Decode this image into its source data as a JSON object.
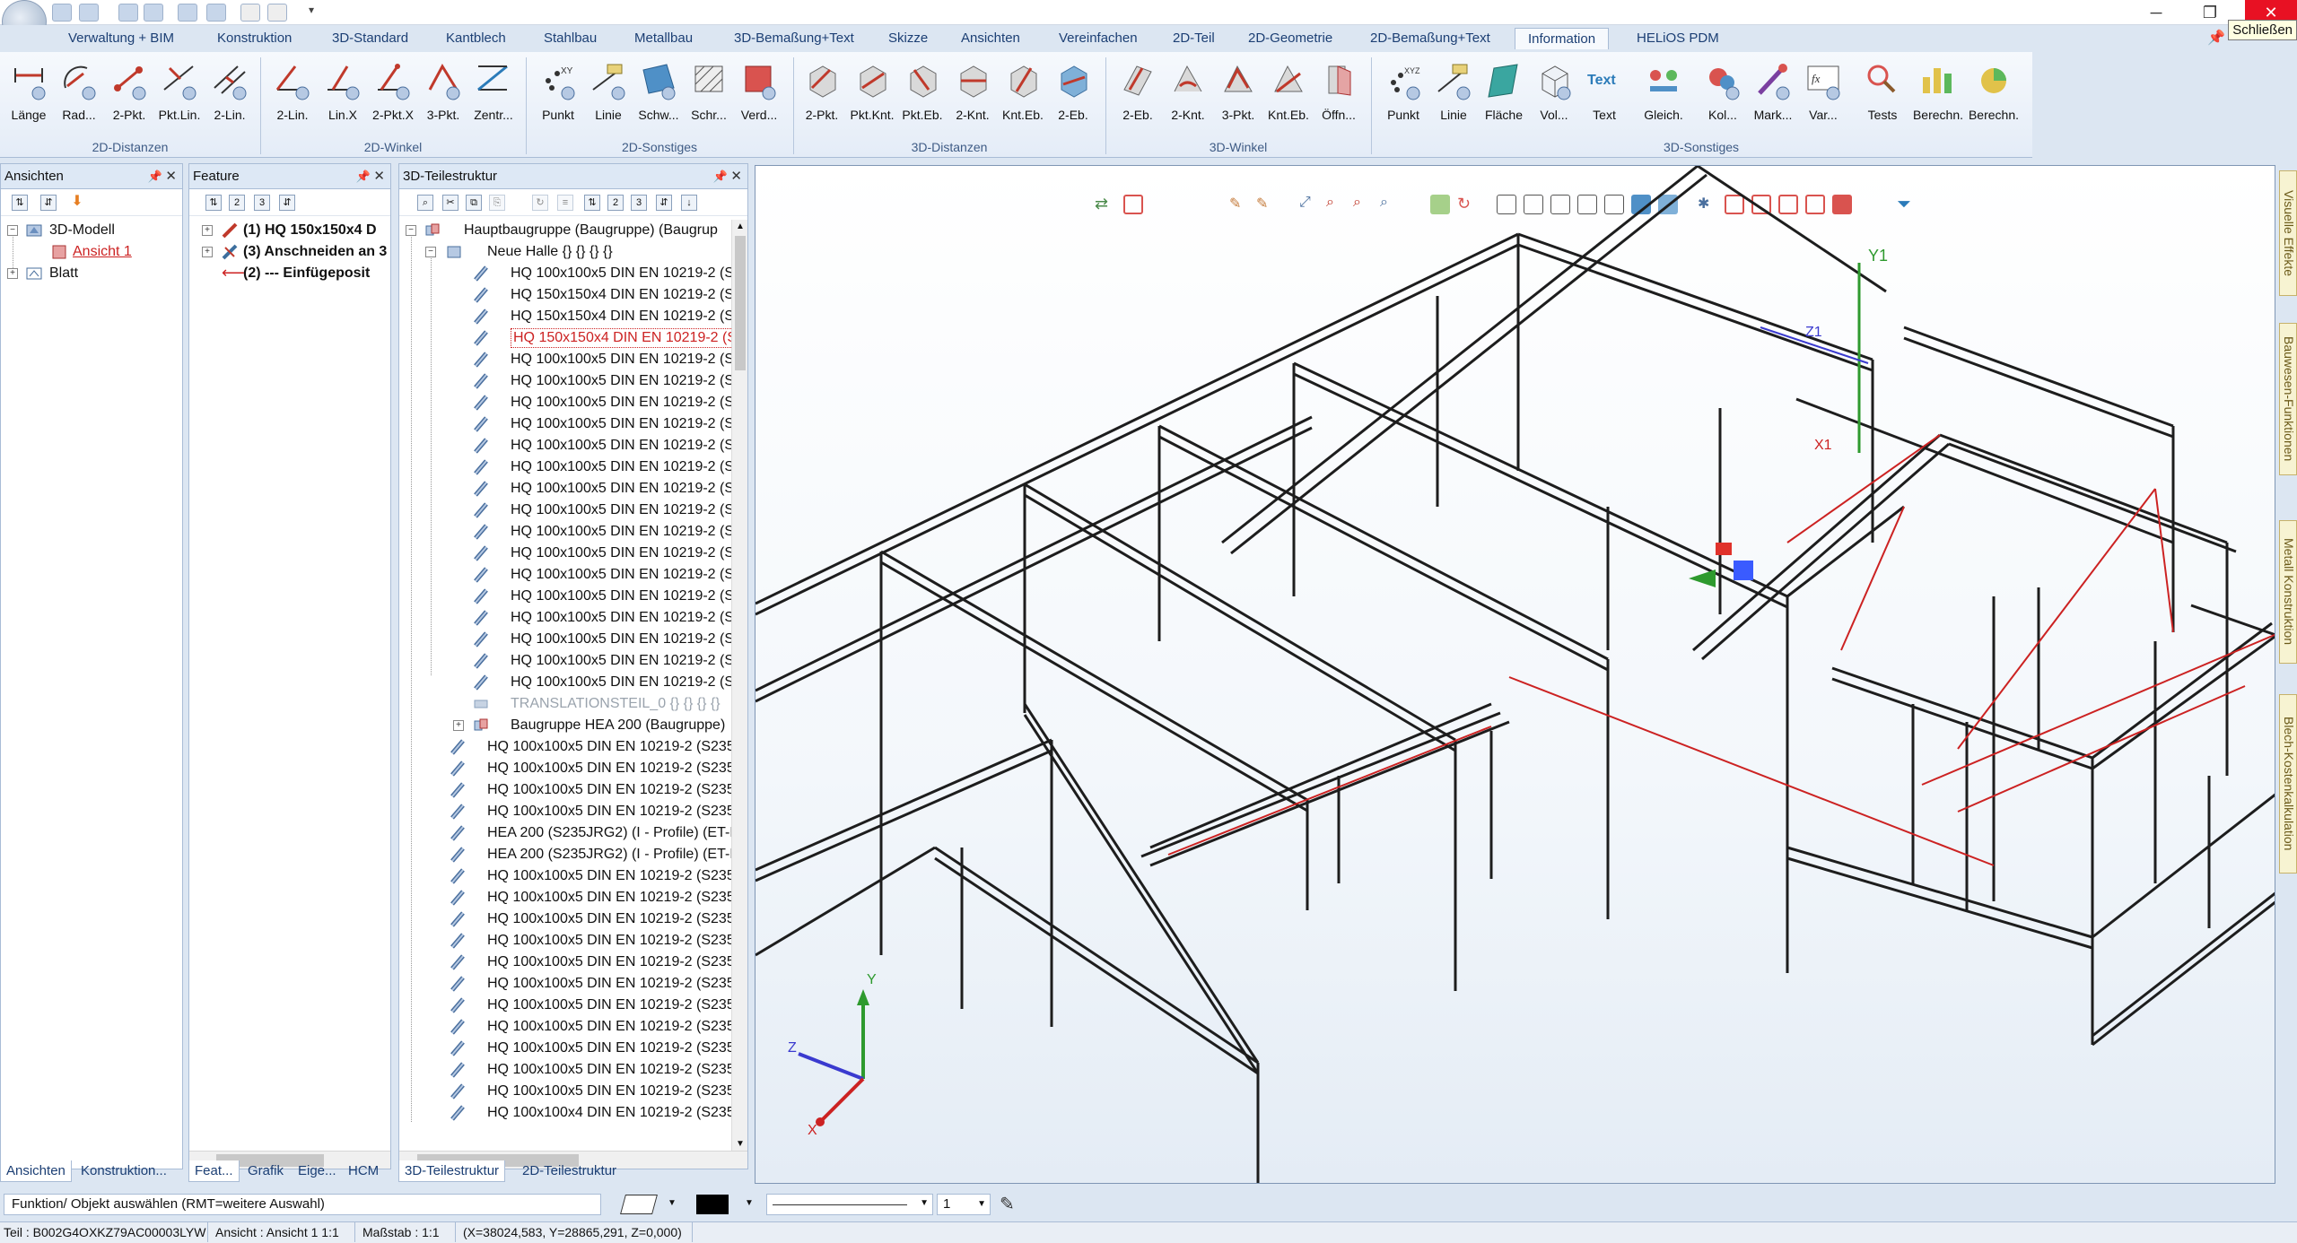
{
  "window": {
    "close_tooltip": "Schließen"
  },
  "menu_tabs": [
    "Verwaltung + BIM",
    "Konstruktion",
    "3D-Standard",
    "Kantblech",
    "Stahlbau",
    "Metallbau",
    "3D-Bemaßung+Text",
    "Skizze",
    "Ansichten",
    "Vereinfachen",
    "2D-Teil",
    "2D-Geometrie",
    "2D-Bemaßung+Text",
    "Information",
    "HELiOS PDM"
  ],
  "active_tab": "Information",
  "ribbon_groups": [
    {
      "label": "2D-Distanzen",
      "buttons": [
        "Länge",
        "Rad...",
        "2-Pkt.",
        "Pkt.Lin.",
        "2-Lin."
      ]
    },
    {
      "label": "2D-Winkel",
      "buttons": [
        "2-Lin.",
        "Lin.X",
        "2-Pkt.X",
        "3-Pkt.",
        "Zentr..."
      ]
    },
    {
      "label": "2D-Sonstiges",
      "buttons": [
        "Punkt",
        "Linie",
        "Schw...",
        "Schr...",
        "Verd..."
      ]
    },
    {
      "label": "3D-Distanzen",
      "buttons": [
        "2-Pkt.",
        "Pkt.Knt.",
        "Pkt.Eb.",
        "2-Knt.",
        "Knt.Eb.",
        "2-Eb."
      ]
    },
    {
      "label": "3D-Winkel",
      "buttons": [
        "2-Eb.",
        "2-Knt.",
        "3-Pkt.",
        "Knt.Eb.",
        "Öffn..."
      ]
    },
    {
      "label": "3D-Sonstiges",
      "buttons": [
        "Punkt",
        "Linie",
        "Fläche",
        "Vol...",
        "Text",
        "Gleich.",
        "Kol...",
        "Mark...",
        "Var...",
        "Tests",
        "Berechn.",
        "Berechn."
      ]
    }
  ],
  "text_button_glyph": "Text",
  "panels": {
    "ansichten": {
      "title": "Ansichten",
      "items": [
        {
          "label": "3D-Modell",
          "level": 0,
          "expander": "−"
        },
        {
          "label": "Ansicht 1",
          "level": 1,
          "expander": ""
        },
        {
          "label": "Blatt",
          "level": 0,
          "expander": "+"
        }
      ]
    },
    "feature": {
      "title": "Feature",
      "items": [
        {
          "label": "(1) HQ 150x150x4 D",
          "expander": "+"
        },
        {
          "label": "(3) Anschneiden an 3",
          "expander": "+"
        },
        {
          "label": "(2) --- Einfügeposit",
          "expander": ""
        }
      ]
    },
    "teilestruktur": {
      "title": "3D-Teilestruktur",
      "root": "Hauptbaugruppe (Baugruppe) (Baugrup",
      "halle": "Neue Halle {} {} {} {}",
      "children": [
        "HQ 100x100x5 DIN EN 10219-2 (S2",
        "HQ 150x150x4 DIN EN 10219-2 (S2",
        "HQ 150x150x4 DIN EN 10219-2 (S2",
        "HQ 150x150x4 DIN EN 10219-2 (S2",
        "HQ 100x100x5 DIN EN 10219-2 (S2",
        "HQ 100x100x5 DIN EN 10219-2 (S2",
        "HQ 100x100x5 DIN EN 10219-2 (S2",
        "HQ 100x100x5 DIN EN 10219-2 (S2",
        "HQ 100x100x5 DIN EN 10219-2 (S2",
        "HQ 100x100x5 DIN EN 10219-2 (S2",
        "HQ 100x100x5 DIN EN 10219-2 (S2",
        "HQ 100x100x5 DIN EN 10219-2 (S2",
        "HQ 100x100x5 DIN EN 10219-2 (S2",
        "HQ 100x100x5 DIN EN 10219-2 (S2",
        "HQ 100x100x5 DIN EN 10219-2 (S2",
        "HQ 100x100x5 DIN EN 10219-2 (S2",
        "HQ 100x100x5 DIN EN 10219-2 (S2",
        "HQ 100x100x5 DIN EN 10219-2 (S2",
        "HQ 100x100x5 DIN EN 10219-2 (S2",
        "HQ 100x100x5 DIN EN 10219-2 (S2"
      ],
      "translation": "TRANSLATIONSTEIL_0 {} {} {} {}",
      "subgroup": "Baugruppe HEA 200 (Baugruppe)",
      "top_items": [
        "HQ 100x100x5 DIN EN 10219-2 (S235J",
        "HQ 100x100x5 DIN EN 10219-2 (S235J",
        "HQ 100x100x5 DIN EN 10219-2 (S235J",
        "HQ 100x100x5 DIN EN 10219-2 (S235J",
        "HEA 200 (S235JRG2) (I - Profile) (ET-I-",
        "HEA 200 (S235JRG2) (I - Profile) (ET-I-",
        "HQ 100x100x5 DIN EN 10219-2 (S235J",
        "HQ 100x100x5 DIN EN 10219-2 (S235J",
        "HQ 100x100x5 DIN EN 10219-2 (S235J",
        "HQ 100x100x5 DIN EN 10219-2 (S235J",
        "HQ 100x100x5 DIN EN 10219-2 (S235J",
        "HQ 100x100x5 DIN EN 10219-2 (S235J",
        "HQ 100x100x5 DIN EN 10219-2 (S235J",
        "HQ 100x100x5 DIN EN 10219-2 (S235J",
        "HQ 100x100x5 DIN EN 10219-2 (S235J",
        "HQ 100x100x5 DIN EN 10219-2 (S235J",
        "HQ 100x100x5 DIN EN 10219-2 (S235J",
        "HQ 100x100x4 DIN EN 10219-2 (S235J"
      ]
    }
  },
  "bottom_tabs": {
    "left": [
      "Ansichten",
      "Konstruktion..."
    ],
    "mid": [
      "Feat...",
      "Grafik",
      "Eige...",
      "HCM"
    ],
    "right": [
      "3D-Teilestruktur",
      "2D-Teilestruktur"
    ]
  },
  "side_tabs": [
    "Visuelle Effekte",
    "Bauwesen-Funktionen",
    "Metall Konstruktion",
    "Blech-Kostenkalkulation"
  ],
  "viewport": {
    "axis_labels": {
      "x": "X",
      "y": "Y",
      "z": "Z"
    },
    "y1_label": "Y1",
    "x1_label": "X1",
    "z1_label": "Z1"
  },
  "command_prompt": "Funktion/ Objekt auswählen (RMT=weitere Auswahl)",
  "line_width": "1",
  "status": {
    "teil": "Teil : B002G4OXKZ79AC00003LYW",
    "ansicht": "Ansicht : Ansicht 1 1:1",
    "massstab": "Maßstab : 1:1",
    "coords": "(X=38024,583, Y=28865,291, Z=0,000)"
  },
  "colors": {
    "accent": "#1c3f74",
    "highlight": "#e81123",
    "selection": "#cc2222"
  }
}
